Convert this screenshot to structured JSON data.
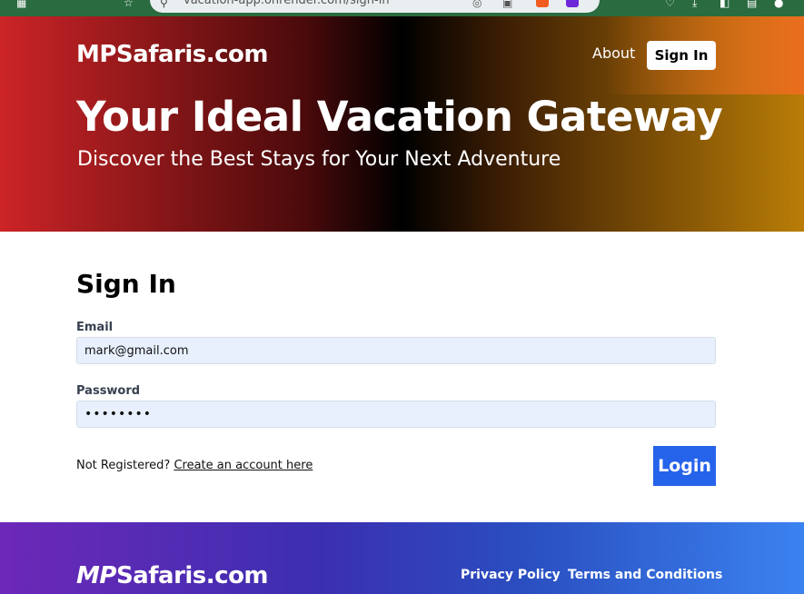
{
  "browser": {
    "url": "vacation-app.onrender.com/sign-in",
    "accent_color": "#2a6b3f"
  },
  "header": {
    "brand": "MPSafaris.com",
    "nav": {
      "about_label": "About",
      "signin_label": "Sign In"
    },
    "hero_title": "Your Ideal Vacation Gateway",
    "hero_subtitle": "Discover the Best Stays for Your Next Adventure"
  },
  "signin_form": {
    "title": "Sign In",
    "email": {
      "label": "Email",
      "value": "mark@gmail.com"
    },
    "password": {
      "label": "Password",
      "value": "••••••••"
    },
    "register_prompt": "Not Registered?",
    "register_link": "Create an account here",
    "login_label": "Login",
    "login_color": "#2563eb"
  },
  "footer": {
    "brand_italic": "MP",
    "brand_rest": "Safaris.com",
    "links": [
      "Privacy Policy",
      "Terms and Conditions"
    ]
  },
  "icons": {
    "browser_glyphs": [
      "grid-icon",
      "star-icon",
      "site-info-icon",
      "brave-shield-icon",
      "extension-icon",
      "heart-icon",
      "download-icon",
      "panel-icon",
      "screenshot-icon"
    ]
  }
}
